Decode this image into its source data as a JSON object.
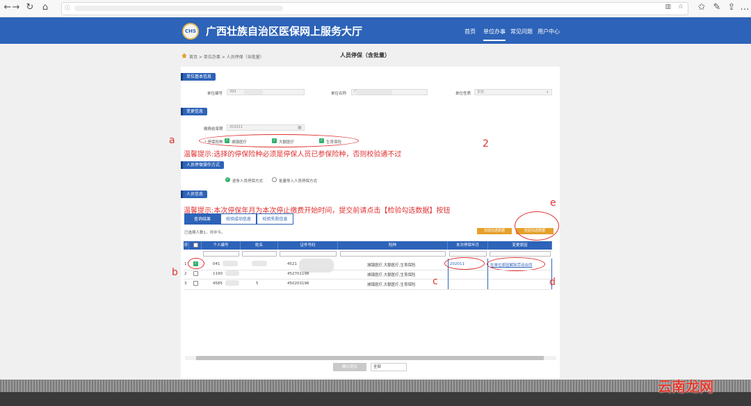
{
  "browser": {
    "nav_icons": [
      "arrow-right-icon",
      "refresh-icon",
      "home-icon"
    ],
    "url": ""
  },
  "site": {
    "logo_text": "CHS",
    "title": "广西壮族自治区医保网上服务大厅",
    "nav": [
      "首页",
      "单位办事",
      "常见问题",
      "用户中心"
    ],
    "active_nav": "单位办事"
  },
  "breadcrumb": "首页 > 单位办事 > 人员停保（含批量）",
  "page_title": "人员停保（含批量）",
  "sections": {
    "basic": "单位基本信息",
    "change": "变更信息",
    "method": "人员停保操作方式",
    "people": "人员信息"
  },
  "basic_info": {
    "unit_no_label": "单位编号",
    "unit_no_value": "393",
    "unit_name_label": "单位名称",
    "unit_name_value": "广",
    "unit_type_label": "单位性质",
    "unit_type_value": "企业"
  },
  "change_info": {
    "end_date_label": "缴费结束期",
    "end_date_value": "202011",
    "insurance_label": "* 停保险种",
    "insurance_options": [
      "城镇医疗",
      "大额医疗",
      "生育保险"
    ]
  },
  "notes": {
    "note1": "温馨提示:选择的停保险种必须是停保人员已参保险种，否则校验通不过",
    "note2": "温馨提示:本次停保年月为本次停止缴费开始时间，提交前请点击【检验勾选数据】按钮"
  },
  "method_options": [
    "逐条人员停保方式",
    "批量导入人员停保方式"
  ],
  "annotations": [
    "a",
    "b",
    "c",
    "d",
    "e",
    "2"
  ],
  "tabs": [
    "查询结果",
    "校验成功信息",
    "校验失败信息"
  ],
  "selected_info": "已选择人数1，共中今。",
  "buttons": {
    "select_all": "勾选勾选数据",
    "verify": "检验勾选数据",
    "submit": "确认提交"
  },
  "table": {
    "headers": [
      "序",
      "",
      "个人编号",
      "姓名",
      "证件号码",
      "险种",
      "本次停保年月",
      "变更原因"
    ],
    "rows": [
      {
        "seq": "1",
        "checked": true,
        "id": "041",
        "name": "",
        "cert": "4521",
        "types": "城镇医疗,大额医疗,生育保险",
        "month": "202011",
        "reason": "在单位原因解除劳动合同"
      },
      {
        "seq": "2",
        "checked": false,
        "id": "1190",
        "name": "",
        "cert": "452701198",
        "types": "城镇医疗,大额医疗,生育保险",
        "month": "",
        "reason": ""
      },
      {
        "seq": "3",
        "checked": false,
        "id": "4585",
        "name": "5",
        "cert": "450203196",
        "types": "城镇医疗,大额医疗,生育保险",
        "month": "",
        "reason": ""
      }
    ]
  },
  "pager": {
    "value": "全部"
  },
  "watermark": "云南龙网",
  "colors": {
    "brand": "#2d63b8",
    "accent": "#e5a02b",
    "annotation": "#e03030",
    "check": "#31b26d"
  }
}
